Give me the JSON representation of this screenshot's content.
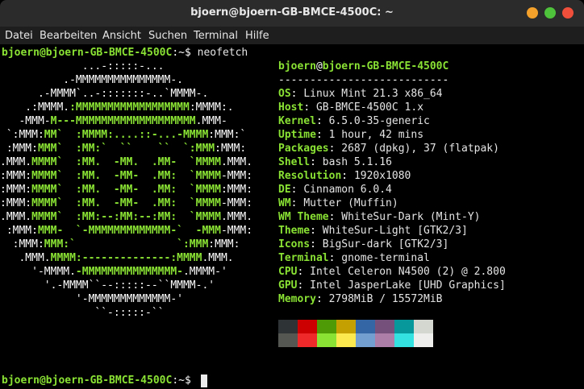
{
  "window": {
    "title": "bjoern@bjoern-GB-BMCE-4500C: ~"
  },
  "menu": [
    "Datei",
    "Bearbeiten",
    "Ansicht",
    "Suchen",
    "Terminal",
    "Hilfe"
  ],
  "prompt": {
    "user_host": "bjoern@bjoern-GB-BMCE-4500C",
    "path": ":~$",
    "command": "neofetch"
  },
  "logo": [
    [
      [
        "w",
        "             ...-:::::-..."
      ]
    ],
    [
      [
        "w",
        "          .-MMMMMMMMMMMMMMM-."
      ]
    ],
    [
      [
        "w",
        "      .-MMMM`..-:::::::-..`MMMM-."
      ]
    ],
    [
      [
        "w",
        "    .:MMMM."
      ],
      [
        "g",
        ":MMMMMMMMMMMMMMMMMM"
      ],
      [
        "w",
        ":MMMM:."
      ]
    ],
    [
      [
        "w",
        "   -MMM-"
      ],
      [
        "g",
        "M---MMMMMMMMMMMMMMMMMMM"
      ],
      [
        "w",
        ".MMM-"
      ]
    ],
    [
      [
        "w",
        " `:MMM:"
      ],
      [
        "g",
        "MM`  :MMMM:....::-...-MMMM"
      ],
      [
        "w",
        ":MMM:`"
      ]
    ],
    [
      [
        "w",
        " :MMM:"
      ],
      [
        "g",
        "MMM`  :MM:`  ``    ``  `:MMM"
      ],
      [
        "w",
        ":MMM:"
      ]
    ],
    [
      [
        "w",
        ".MMM."
      ],
      [
        "g",
        "MMMM`  :MM.  -MM.  .MM-  `MMMM"
      ],
      [
        "w",
        ".MMM."
      ]
    ],
    [
      [
        "w",
        ":MMM:"
      ],
      [
        "g",
        "MMMM`  :MM.  -MM-  .MM:  `MMMM"
      ],
      [
        "w",
        "-MMM:"
      ]
    ],
    [
      [
        "w",
        ":MMM:"
      ],
      [
        "g",
        "MMMM`  :MM.  -MM-  .MM:  `MMMM"
      ],
      [
        "w",
        ":MMM:"
      ]
    ],
    [
      [
        "w",
        ":MMM:"
      ],
      [
        "g",
        "MMMM`  :MM.  -MM-  .MM:  `MMMM"
      ],
      [
        "w",
        "-MMM:"
      ]
    ],
    [
      [
        "w",
        ".MMM."
      ],
      [
        "g",
        "MMMM`  :MM:--:MM:--:MM:  `MMMM"
      ],
      [
        "w",
        ".MMM."
      ]
    ],
    [
      [
        "w",
        " :MMM:"
      ],
      [
        "g",
        "MMM-  `-MMMMMMMMMMMMM-`  -MMM"
      ],
      [
        "w",
        "-MMM:"
      ]
    ],
    [
      [
        "w",
        "  :MMM:"
      ],
      [
        "g",
        "MMM:`                `:MMM"
      ],
      [
        "w",
        ":MMM:"
      ]
    ],
    [
      [
        "w",
        "   .MMM."
      ],
      [
        "g",
        "MMMM:--------------:MMMM"
      ],
      [
        "w",
        ".MMM."
      ]
    ],
    [
      [
        "w",
        "     '-MMMM."
      ],
      [
        "g",
        "-MMMMMMMMMMMMMMM-"
      ],
      [
        "w",
        ".MMMM-'"
      ]
    ],
    [
      [
        "w",
        "       '.-MMMM``--:::::--``MMMM-.'"
      ]
    ],
    [
      [
        "w",
        "            '-MMMMMMMMMMMMM-'"
      ]
    ],
    [
      [
        "w",
        "               ``-:::::-``"
      ]
    ]
  ],
  "info": {
    "header_user": "bjoern",
    "header_at": "@",
    "header_host": "bjoern-GB-BMCE-4500C",
    "separator": "---------------------------",
    "rows": [
      {
        "key": "OS",
        "value": "Linux Mint 21.3 x86_64"
      },
      {
        "key": "Host",
        "value": "GB-BMCE-4500C 1.x"
      },
      {
        "key": "Kernel",
        "value": "6.5.0-35-generic"
      },
      {
        "key": "Uptime",
        "value": "1 hour, 42 mins"
      },
      {
        "key": "Packages",
        "value": "2687 (dpkg), 37 (flatpak)"
      },
      {
        "key": "Shell",
        "value": "bash 5.1.16"
      },
      {
        "key": "Resolution",
        "value": "1920x1080"
      },
      {
        "key": "DE",
        "value": "Cinnamon 6.0.4"
      },
      {
        "key": "WM",
        "value": "Mutter (Muffin)"
      },
      {
        "key": "WM Theme",
        "value": "WhiteSur-Dark (Mint-Y)"
      },
      {
        "key": "Theme",
        "value": "WhiteSur-Light [GTK2/3]"
      },
      {
        "key": "Icons",
        "value": "BigSur-dark [GTK2/3]"
      },
      {
        "key": "Terminal",
        "value": "gnome-terminal"
      },
      {
        "key": "CPU",
        "value": "Intel Celeron N4500 (2) @ 2.800"
      },
      {
        "key": "GPU",
        "value": "Intel JasperLake [UHD Graphics]"
      },
      {
        "key": "Memory",
        "value": "2798MiB / 15572MiB"
      }
    ]
  },
  "palette": {
    "row1": [
      "#2e3436",
      "#cc0000",
      "#4e9a06",
      "#c4a000",
      "#3465a4",
      "#75507b",
      "#06989a",
      "#d3d7cf"
    ],
    "row2": [
      "#555753",
      "#ef2929",
      "#8ae234",
      "#fce94f",
      "#729fcf",
      "#ad7fa8",
      "#34e2e2",
      "#eeeeec"
    ]
  }
}
